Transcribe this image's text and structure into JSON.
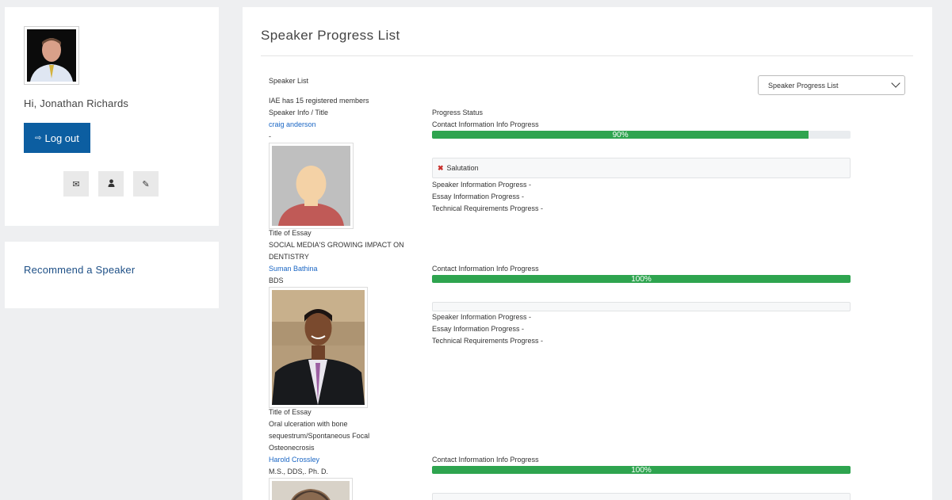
{
  "user": {
    "greeting": "Hi, Jonathan Richards",
    "logout_label": "Log out",
    "logout_icon": "sign-out-icon",
    "actions": [
      {
        "name": "envelope-icon",
        "glyph": "✉"
      },
      {
        "name": "user-icon",
        "glyph": "👤"
      },
      {
        "name": "pencil-icon",
        "glyph": "✎"
      }
    ]
  },
  "sidebar": {
    "recommend_label": "Recommend a Speaker"
  },
  "main": {
    "title": "Speaker Progress List",
    "select_value": "Speaker Progress List",
    "list_label": "Speaker List",
    "member_count_text": "IAE has 15 registered members",
    "col_info_header": "Speaker Info / Title",
    "col_status_header": "Progress Status"
  },
  "speakers": [
    {
      "name": "craig anderson",
      "title": "-",
      "essay_label": "Title of Essay",
      "essay_lines": [
        "SOCIAL MEDIA'S GROWING IMPACT ON",
        "DENTISTRY"
      ],
      "contact_label": "Contact Information Info Progress",
      "contact_progress": 90,
      "contact_progress_text": "90%",
      "missing_items": [
        "Salutation"
      ],
      "speaker_info_progress": "Speaker Information Progress -",
      "essay_info_progress": "Essay Information Progress -",
      "tech_progress": "Technical Requirements Progress -"
    },
    {
      "name": "Suman Bathina",
      "title": "BDS",
      "essay_label": "Title of Essay",
      "essay_lines": [
        "Oral ulceration with bone",
        "sequestrum/Spontaneous Focal",
        "Osteonecrosis"
      ],
      "contact_label": "Contact Information Info Progress",
      "contact_progress": 100,
      "contact_progress_text": "100%",
      "missing_items": [],
      "speaker_info_progress": "Speaker Information Progress -",
      "essay_info_progress": "Essay Information Progress -",
      "tech_progress": "Technical Requirements Progress -"
    },
    {
      "name": "Harold Crossley",
      "title": "M.S., DDS,. Ph. D.",
      "contact_label": "Contact Information Info Progress",
      "contact_progress": 100,
      "contact_progress_text": "100%"
    }
  ],
  "colors": {
    "primary": "#0c5ea1",
    "link": "#1a66c4",
    "progress": "#2ea44f",
    "alert_x": "#c9302c"
  }
}
